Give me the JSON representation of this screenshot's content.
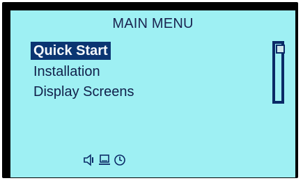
{
  "menu": {
    "title": "MAIN MENU",
    "items": [
      {
        "label": "Quick Start",
        "selected": true
      },
      {
        "label": "Installation",
        "selected": false
      },
      {
        "label": "Display Screens",
        "selected": false
      }
    ]
  },
  "scrollbar": {
    "position_fraction": 0
  },
  "status_bar": {
    "icons": [
      "speaker-icon",
      "computer-icon",
      "clock-icon"
    ]
  },
  "colors": {
    "screen_background": "#9ef0f3",
    "frame": "#000000",
    "text": "#10204a",
    "selection_background": "#0b3572",
    "selection_text": "#f4f8fb"
  }
}
